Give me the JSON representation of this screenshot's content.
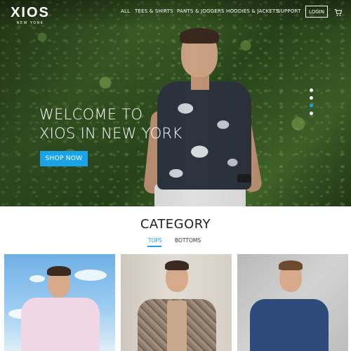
{
  "brand": {
    "name": "XIOS",
    "tagline": "NEW YORK"
  },
  "nav": {
    "items": [
      "ALL",
      "TEES & SHIRTS",
      "PANTS & JOGGERS",
      "HOODIES & JACKETS",
      "SUPPORT"
    ],
    "login_label": "LOGIN",
    "cart_icon": "cart-icon"
  },
  "hero": {
    "title_line1": "WELCOME TO",
    "title_line2": "XIOS IN NEW YORK",
    "cta_label": "SHOP NOW",
    "slides_count": 4,
    "active_slide": 3
  },
  "category": {
    "title": "CATEGORY",
    "tabs": [
      {
        "label": "TOPS",
        "active": true
      },
      {
        "label": "BOTTOMS",
        "active": false
      }
    ]
  },
  "colors": {
    "accent": "#1aa3e8",
    "text": "#222222",
    "background": "#ffffff"
  }
}
